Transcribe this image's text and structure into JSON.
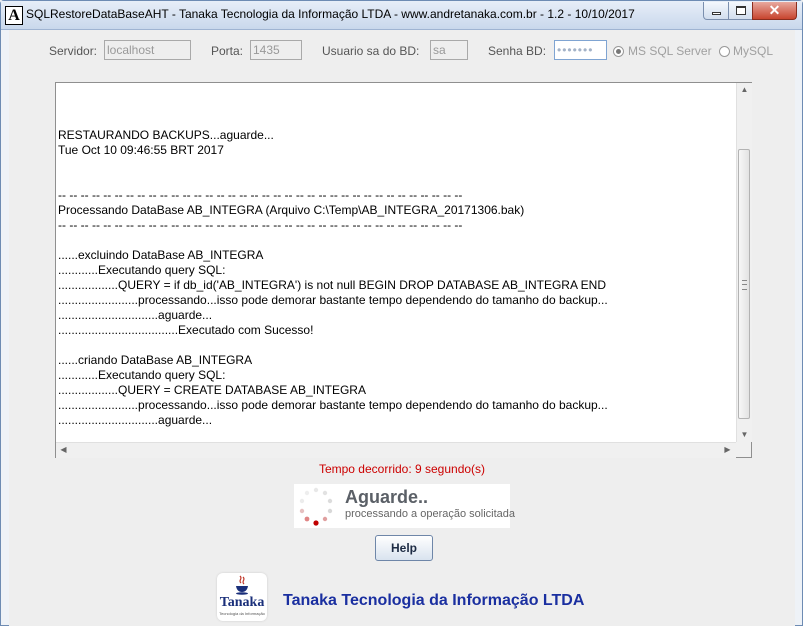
{
  "window": {
    "title": "SQLRestoreDataBaseAHT - Tanaka Tecnologia da Informação LTDA - www.andretanaka.com.br - 1.2 - 10/10/2017",
    "app_icon_letter": "A"
  },
  "connection": {
    "server_label": "Servidor:",
    "server_value": "localhost",
    "port_label": "Porta:",
    "port_value": "1435",
    "user_label": "Usuario sa do BD:",
    "user_value": "sa",
    "password_label": "Senha BD:",
    "password_value": "•••••••",
    "db_options": [
      {
        "label": "MS SQL Server",
        "selected": true
      },
      {
        "label": "MySQL",
        "selected": false
      }
    ]
  },
  "log_lines": [
    "",
    "RESTAURANDO BACKUPS...aguarde...",
    "Tue Oct 10 09:46:55 BRT 2017",
    "",
    "",
    "-- -- -- -- -- -- -- -- -- -- -- -- -- -- -- -- -- -- -- -- -- -- -- -- -- -- -- -- -- -- -- -- -- -- -- --",
    "Processando DataBase AB_INTEGRA (Arquivo C:\\Temp\\AB_INTEGRA_20171306.bak)",
    "-- -- -- -- -- -- -- -- -- -- -- -- -- -- -- -- -- -- -- -- -- -- -- -- -- -- -- -- -- -- -- -- -- -- -- --",
    "",
    "......excluindo DataBase AB_INTEGRA",
    "............Executando query SQL:",
    "..................QUERY = if db_id('AB_INTEGRA') is not null BEGIN DROP DATABASE AB_INTEGRA END",
    "........................processando...isso pode demorar bastante tempo dependendo do tamanho do backup...",
    "..............................aguarde...",
    "....................................Executado com Sucesso!",
    "",
    "......criando DataBase AB_INTEGRA",
    "............Executando query SQL:",
    "..................QUERY = CREATE DATABASE AB_INTEGRA",
    "........................processando...isso pode demorar bastante tempo dependendo do tamanho do backup...",
    "..............................aguarde..."
  ],
  "status": {
    "elapsed": "Tempo decorrido: 9 segundo(s)"
  },
  "wait": {
    "title": "Aguarde..",
    "subtitle": "processando a operação solicitada"
  },
  "help_label": "Help",
  "footer": {
    "logo_name": "Tanaka",
    "logo_tagline": "Tecnologia da Informação",
    "company": "Tanaka Tecnologia da Informação LTDA"
  },
  "colors": {
    "elapsed_text": "#cc0000",
    "company_text": "#1a2fa0",
    "spinner_active": "#c00000"
  },
  "icons": {
    "app": "app-a-icon",
    "minimize": "minimize-icon",
    "maximize": "maximize-icon",
    "close": "close-icon",
    "spinner": "loading-spinner-icon",
    "scroll_up": "scroll-up-icon",
    "scroll_down": "scroll-down-icon",
    "scroll_left": "scroll-left-icon",
    "scroll_right": "scroll-right-icon"
  }
}
